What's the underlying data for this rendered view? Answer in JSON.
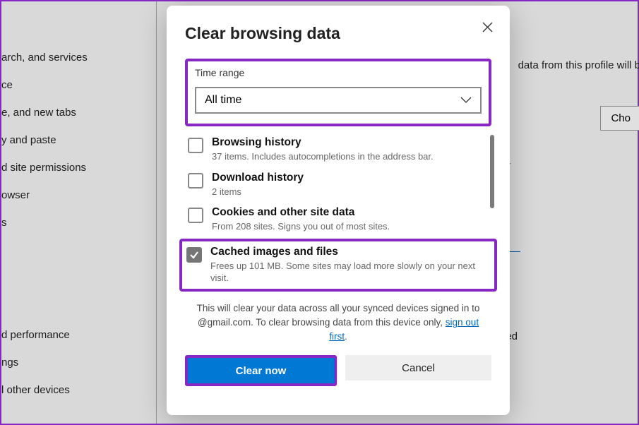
{
  "sidebar": {
    "items": [
      "arch, and services",
      "ce",
      "e, and new tabs",
      "y and paste",
      "d site permissions",
      "owser",
      "s",
      "d performance",
      "ngs",
      "l other devices"
    ]
  },
  "background": {
    "profile_text": "data from this profile will b",
    "choose_label": "Cho",
    "letter_r": "r",
    "ed_text": "ed"
  },
  "dialog": {
    "title": "Clear browsing data",
    "time_range": {
      "label": "Time range",
      "value": "All time"
    },
    "options": [
      {
        "title": "Browsing history",
        "sub": "37 items. Includes autocompletions in the address bar.",
        "checked": false
      },
      {
        "title": "Download history",
        "sub": "2 items",
        "checked": false
      },
      {
        "title": "Cookies and other site data",
        "sub": "From 208 sites. Signs you out of most sites.",
        "checked": false
      },
      {
        "title": "Cached images and files",
        "sub": "Frees up 101 MB. Some sites may load more slowly on your next visit.",
        "checked": true
      }
    ],
    "note_prefix": "This will clear your data across all your synced devices signed in to ",
    "note_email_suffix": "@gmail.com. To clear browsing data from this device only, ",
    "note_link": "sign out first",
    "note_period": ".",
    "clear_button": "Clear now",
    "cancel_button": "Cancel"
  }
}
